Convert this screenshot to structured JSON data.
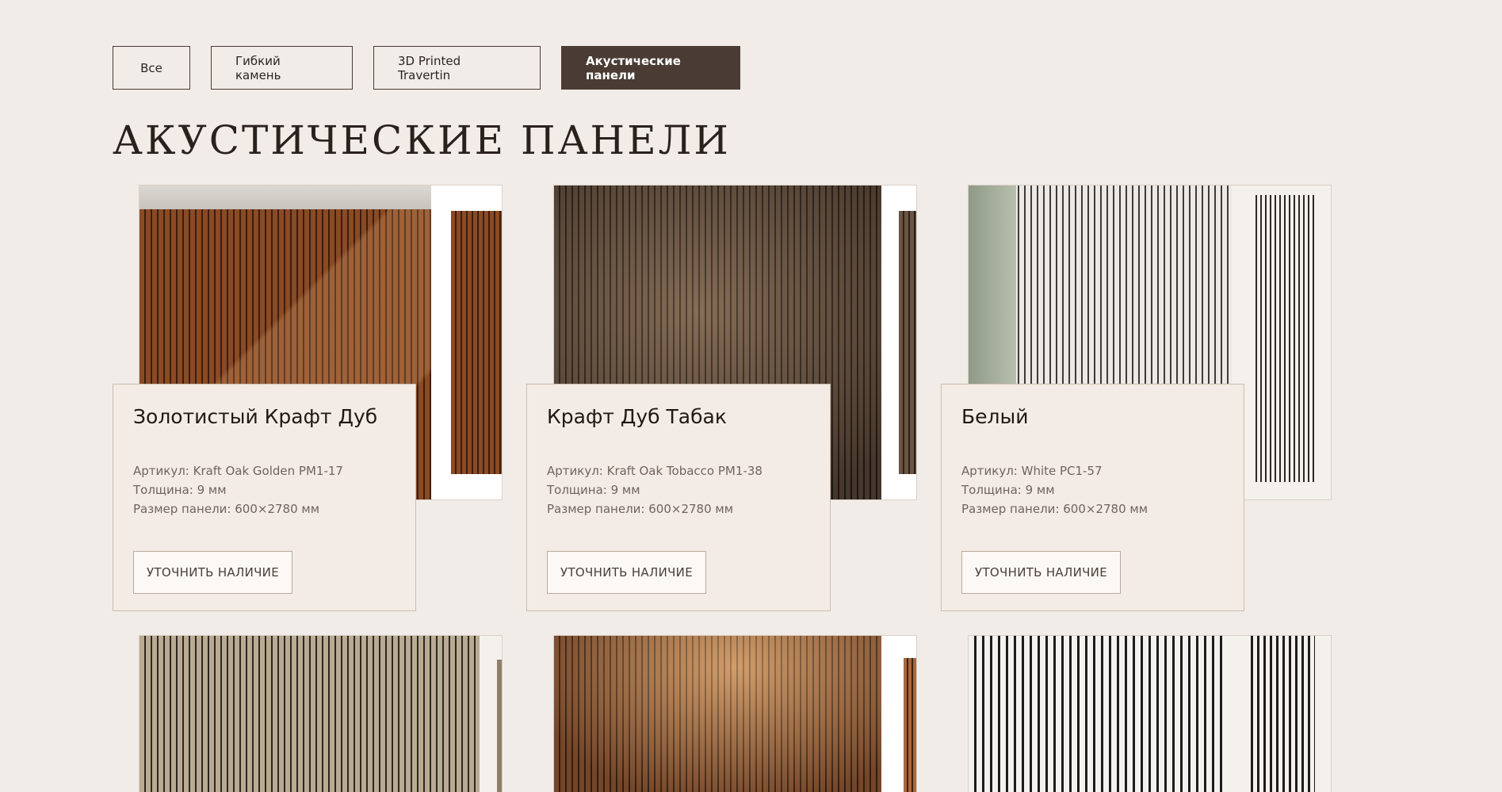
{
  "filters": [
    {
      "label": "Все",
      "active": false
    },
    {
      "label": "Гибкий камень",
      "active": false
    },
    {
      "label": "3D Printed Travertin",
      "active": false
    },
    {
      "label": "Акустические панели",
      "active": true
    }
  ],
  "page_title": "АКУСТИЧЕСКИЕ ПАНЕЛИ",
  "products": [
    {
      "name": "Золотистый Крафт Дуб",
      "sku": "Артикул: Kraft Oak Golden PM1-17",
      "thickness": "Толщина: 9 мм",
      "size": "Размер панели: 600×2780 мм",
      "cta": "УТОЧНИТЬ НАЛИЧИЕ"
    },
    {
      "name": "Крафт Дуб Табак",
      "sku": "Артикул: Kraft Oak Tobacco PM1-38",
      "thickness": "Толщина: 9 мм",
      "size": "Размер панели: 600×2780 мм",
      "cta": "УТОЧНИТЬ НАЛИЧИЕ"
    },
    {
      "name": "Белый",
      "sku": "Артикул: White PC1-57",
      "thickness": "Толщина: 9 мм",
      "size": "Размер панели: 600×2780 мм",
      "cta": "УТОЧНИТЬ НАЛИЧИЕ"
    }
  ],
  "colors": {
    "background": "#f1ece8",
    "accent": "#4a3c34",
    "card_background": "#f3ece6"
  }
}
